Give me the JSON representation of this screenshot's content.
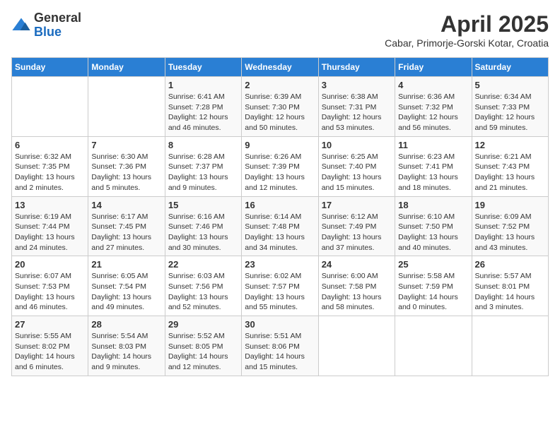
{
  "logo": {
    "general": "General",
    "blue": "Blue"
  },
  "header": {
    "title": "April 2025",
    "subtitle": "Cabar, Primorje-Gorski Kotar, Croatia"
  },
  "days_of_week": [
    "Sunday",
    "Monday",
    "Tuesday",
    "Wednesday",
    "Thursday",
    "Friday",
    "Saturday"
  ],
  "weeks": [
    [
      {
        "day": "",
        "info": ""
      },
      {
        "day": "",
        "info": ""
      },
      {
        "day": "1",
        "info": "Sunrise: 6:41 AM\nSunset: 7:28 PM\nDaylight: 12 hours and 46 minutes."
      },
      {
        "day": "2",
        "info": "Sunrise: 6:39 AM\nSunset: 7:30 PM\nDaylight: 12 hours and 50 minutes."
      },
      {
        "day": "3",
        "info": "Sunrise: 6:38 AM\nSunset: 7:31 PM\nDaylight: 12 hours and 53 minutes."
      },
      {
        "day": "4",
        "info": "Sunrise: 6:36 AM\nSunset: 7:32 PM\nDaylight: 12 hours and 56 minutes."
      },
      {
        "day": "5",
        "info": "Sunrise: 6:34 AM\nSunset: 7:33 PM\nDaylight: 12 hours and 59 minutes."
      }
    ],
    [
      {
        "day": "6",
        "info": "Sunrise: 6:32 AM\nSunset: 7:35 PM\nDaylight: 13 hours and 2 minutes."
      },
      {
        "day": "7",
        "info": "Sunrise: 6:30 AM\nSunset: 7:36 PM\nDaylight: 13 hours and 5 minutes."
      },
      {
        "day": "8",
        "info": "Sunrise: 6:28 AM\nSunset: 7:37 PM\nDaylight: 13 hours and 9 minutes."
      },
      {
        "day": "9",
        "info": "Sunrise: 6:26 AM\nSunset: 7:39 PM\nDaylight: 13 hours and 12 minutes."
      },
      {
        "day": "10",
        "info": "Sunrise: 6:25 AM\nSunset: 7:40 PM\nDaylight: 13 hours and 15 minutes."
      },
      {
        "day": "11",
        "info": "Sunrise: 6:23 AM\nSunset: 7:41 PM\nDaylight: 13 hours and 18 minutes."
      },
      {
        "day": "12",
        "info": "Sunrise: 6:21 AM\nSunset: 7:43 PM\nDaylight: 13 hours and 21 minutes."
      }
    ],
    [
      {
        "day": "13",
        "info": "Sunrise: 6:19 AM\nSunset: 7:44 PM\nDaylight: 13 hours and 24 minutes."
      },
      {
        "day": "14",
        "info": "Sunrise: 6:17 AM\nSunset: 7:45 PM\nDaylight: 13 hours and 27 minutes."
      },
      {
        "day": "15",
        "info": "Sunrise: 6:16 AM\nSunset: 7:46 PM\nDaylight: 13 hours and 30 minutes."
      },
      {
        "day": "16",
        "info": "Sunrise: 6:14 AM\nSunset: 7:48 PM\nDaylight: 13 hours and 34 minutes."
      },
      {
        "day": "17",
        "info": "Sunrise: 6:12 AM\nSunset: 7:49 PM\nDaylight: 13 hours and 37 minutes."
      },
      {
        "day": "18",
        "info": "Sunrise: 6:10 AM\nSunset: 7:50 PM\nDaylight: 13 hours and 40 minutes."
      },
      {
        "day": "19",
        "info": "Sunrise: 6:09 AM\nSunset: 7:52 PM\nDaylight: 13 hours and 43 minutes."
      }
    ],
    [
      {
        "day": "20",
        "info": "Sunrise: 6:07 AM\nSunset: 7:53 PM\nDaylight: 13 hours and 46 minutes."
      },
      {
        "day": "21",
        "info": "Sunrise: 6:05 AM\nSunset: 7:54 PM\nDaylight: 13 hours and 49 minutes."
      },
      {
        "day": "22",
        "info": "Sunrise: 6:03 AM\nSunset: 7:56 PM\nDaylight: 13 hours and 52 minutes."
      },
      {
        "day": "23",
        "info": "Sunrise: 6:02 AM\nSunset: 7:57 PM\nDaylight: 13 hours and 55 minutes."
      },
      {
        "day": "24",
        "info": "Sunrise: 6:00 AM\nSunset: 7:58 PM\nDaylight: 13 hours and 58 minutes."
      },
      {
        "day": "25",
        "info": "Sunrise: 5:58 AM\nSunset: 7:59 PM\nDaylight: 14 hours and 0 minutes."
      },
      {
        "day": "26",
        "info": "Sunrise: 5:57 AM\nSunset: 8:01 PM\nDaylight: 14 hours and 3 minutes."
      }
    ],
    [
      {
        "day": "27",
        "info": "Sunrise: 5:55 AM\nSunset: 8:02 PM\nDaylight: 14 hours and 6 minutes."
      },
      {
        "day": "28",
        "info": "Sunrise: 5:54 AM\nSunset: 8:03 PM\nDaylight: 14 hours and 9 minutes."
      },
      {
        "day": "29",
        "info": "Sunrise: 5:52 AM\nSunset: 8:05 PM\nDaylight: 14 hours and 12 minutes."
      },
      {
        "day": "30",
        "info": "Sunrise: 5:51 AM\nSunset: 8:06 PM\nDaylight: 14 hours and 15 minutes."
      },
      {
        "day": "",
        "info": ""
      },
      {
        "day": "",
        "info": ""
      },
      {
        "day": "",
        "info": ""
      }
    ]
  ]
}
